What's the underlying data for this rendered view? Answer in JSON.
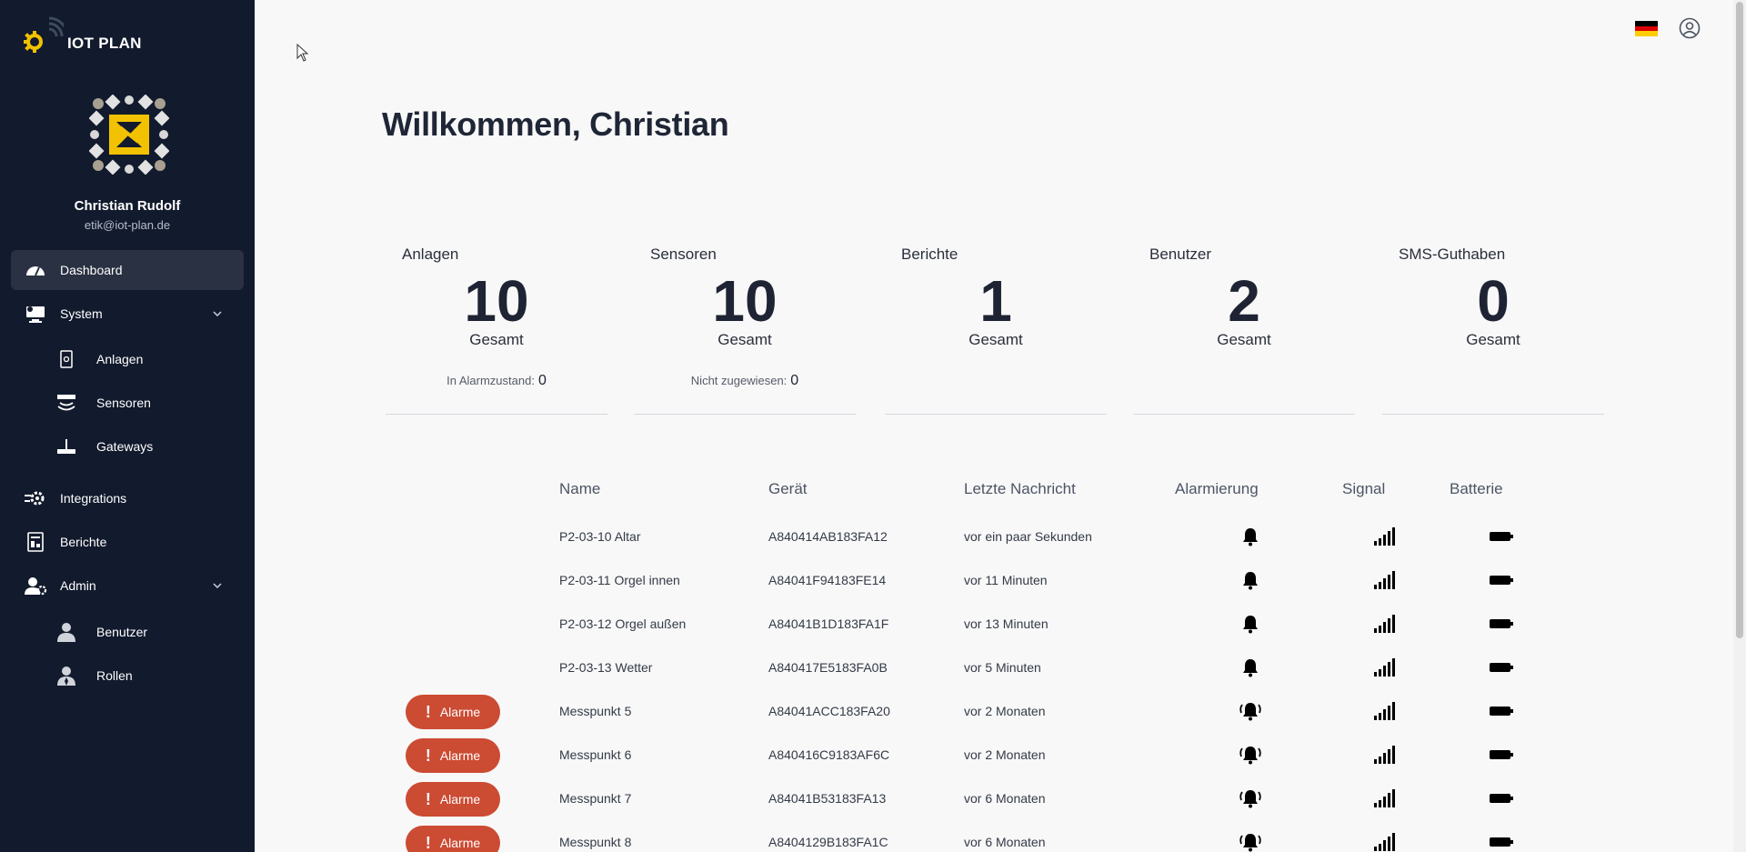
{
  "brand": {
    "name": "IOT PLAN"
  },
  "user": {
    "name": "Christian Rudolf",
    "email": "etik@iot-plan.de"
  },
  "nav": {
    "dashboard": "Dashboard",
    "system": "System",
    "anlagen": "Anlagen",
    "sensoren": "Sensoren",
    "gateways": "Gateways",
    "integrations": "Integrations",
    "berichte": "Berichte",
    "admin": "Admin",
    "benutzer": "Benutzer",
    "rollen": "Rollen"
  },
  "header": {
    "welcome": "Willkommen, Christian"
  },
  "stats": [
    {
      "label": "Anlagen",
      "value": "10",
      "total": "Gesamt",
      "sub_label": "In Alarmzustand:",
      "sub_value": "0"
    },
    {
      "label": "Sensoren",
      "value": "10",
      "total": "Gesamt",
      "sub_label": "Nicht zugewiesen:",
      "sub_value": "0"
    },
    {
      "label": "Berichte",
      "value": "1",
      "total": "Gesamt"
    },
    {
      "label": "Benutzer",
      "value": "2",
      "total": "Gesamt"
    },
    {
      "label": "SMS-Guthaben",
      "value": "0",
      "total": "Gesamt"
    }
  ],
  "table": {
    "headers": {
      "name": "Name",
      "device": "Gerät",
      "last": "Letzte Nachricht",
      "alarm": "Alarmierung",
      "signal": "Signal",
      "battery": "Batterie"
    },
    "alarm_label": "Alarme",
    "rows": [
      {
        "name": "P2-03-10 Altar",
        "device": "A840414AB183FA12",
        "last": "vor ein paar Sekunden",
        "alarm": false
      },
      {
        "name": "P2-03-11 Orgel innen",
        "device": "A84041F94183FE14",
        "last": "vor 11 Minuten",
        "alarm": false
      },
      {
        "name": "P2-03-12 Orgel außen",
        "device": "A84041B1D183FA1F",
        "last": "vor 13 Minuten",
        "alarm": false
      },
      {
        "name": "P2-03-13 Wetter",
        "device": "A840417E5183FA0B",
        "last": "vor 5 Minuten",
        "alarm": false
      },
      {
        "name": "Messpunkt 5",
        "device": "A84041ACC183FA20",
        "last": "vor 2 Monaten",
        "alarm": true
      },
      {
        "name": "Messpunkt 6",
        "device": "A840416C9183AF6C",
        "last": "vor 2 Monaten",
        "alarm": true
      },
      {
        "name": "Messpunkt 7",
        "device": "A84041B53183FA13",
        "last": "vor 6 Monaten",
        "alarm": true
      },
      {
        "name": "Messpunkt 8",
        "device": "A8404129B183FA1C",
        "last": "vor 6 Monaten",
        "alarm": true
      }
    ]
  },
  "colors": {
    "sidebar": "#121a2d",
    "accent": "#f2c200",
    "alarm": "#cc4b33"
  }
}
